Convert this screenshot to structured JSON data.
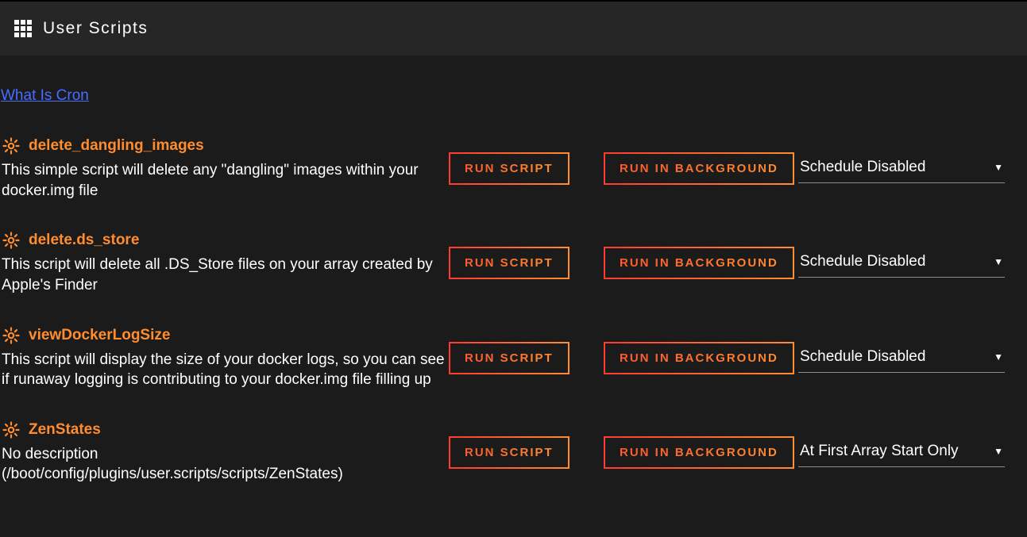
{
  "header": {
    "title": "User Scripts"
  },
  "link": {
    "what_is_cron": "What Is Cron"
  },
  "buttons": {
    "run_script": "RUN SCRIPT",
    "run_background": "RUN IN BACKGROUND"
  },
  "scripts": [
    {
      "name": "delete_dangling_images",
      "description": "This simple script will delete any \"dangling\" images within your docker.img file",
      "schedule": "Schedule Disabled"
    },
    {
      "name": "delete.ds_store",
      "description": "This script will delete all .DS_Store files on your array created by Apple's Finder",
      "schedule": "Schedule Disabled"
    },
    {
      "name": "viewDockerLogSize",
      "description": "This script will display the size of your docker logs, so you can see if runaway logging is contributing to your docker.img file filling up",
      "schedule": "Schedule Disabled"
    },
    {
      "name": "ZenStates",
      "description": "No description\n(/boot/config/plugins/user.scripts/scripts/ZenStates)",
      "schedule": "At First Array Start Only"
    }
  ]
}
